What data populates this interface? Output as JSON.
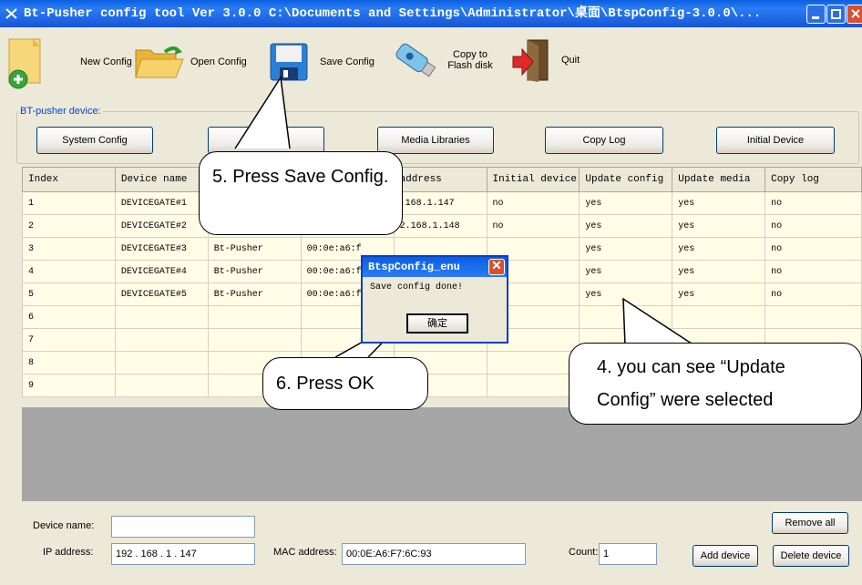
{
  "window": {
    "title": "Bt-Pusher config tool Ver 3.0.0    C:\\Documents and Settings\\Administrator\\桌面\\BtspConfig-3.0.0\\..."
  },
  "toolbar": {
    "new_config": "New Config",
    "open_config": "Open Config",
    "save_config": "Save Config",
    "copy_flash": "Copy to Flash disk",
    "quit": "Quit"
  },
  "group": {
    "title": "BT-pusher device:",
    "buttons": [
      "System Config",
      "",
      "Media Libraries",
      "Copy Log",
      "Initial Device"
    ]
  },
  "grid": {
    "columns": [
      "Index",
      "Device name",
      "",
      "",
      "address",
      "Initial device",
      "Update config",
      "Update media",
      "Copy log"
    ],
    "rows": [
      [
        "1",
        "DEVICEGATE#1",
        "",
        "",
        ".168.1.147",
        "no",
        "yes",
        "yes",
        "no"
      ],
      [
        "2",
        "DEVICEGATE#2",
        "",
        "",
        "2.168.1.148",
        "no",
        "yes",
        "yes",
        "no"
      ],
      [
        "3",
        "DEVICEGATE#3",
        "Bt-Pusher",
        "00:0e:a6:f",
        "",
        "",
        "yes",
        "yes",
        "no"
      ],
      [
        "4",
        "DEVICEGATE#4",
        "Bt-Pusher",
        "00:0e:a6:f",
        "",
        "",
        "yes",
        "yes",
        "no"
      ],
      [
        "5",
        "DEVICEGATE#5",
        "Bt-Pusher",
        "00:0e:a6:f",
        "",
        "",
        "yes",
        "yes",
        "no"
      ],
      [
        "6",
        "",
        "",
        "",
        "",
        "",
        "",
        "",
        ""
      ],
      [
        "7",
        "",
        "",
        "",
        "",
        "",
        "",
        "",
        ""
      ],
      [
        "8",
        "",
        "",
        "",
        "",
        "",
        "",
        "",
        ""
      ],
      [
        "9",
        "",
        "",
        "",
        "",
        "",
        "",
        "",
        ""
      ]
    ]
  },
  "form": {
    "device_name_label": "Device name:",
    "device_name_value": "",
    "ip_label": "IP address:",
    "ip_value": "192 . 168 . 1 . 147",
    "mac_label": "MAC address:",
    "mac_value": "00:0E:A6:F7:6C:93",
    "count_label": "Count:",
    "count_value": "1",
    "add_device": "Add device",
    "remove_all": "Remove all",
    "delete_device": "Delete device"
  },
  "dialog": {
    "title": "BtspConfig_enu",
    "message": "Save config done!",
    "ok": "确定"
  },
  "callouts": {
    "step5": "5. Press Save Config.",
    "step6": "6. Press OK",
    "step4": "4. you can see “Update Config” were selected"
  },
  "colors": {
    "titlebar": "#0a5fe0",
    "grid_row": "#fffde6",
    "grey_area": "#a6a6a6"
  }
}
